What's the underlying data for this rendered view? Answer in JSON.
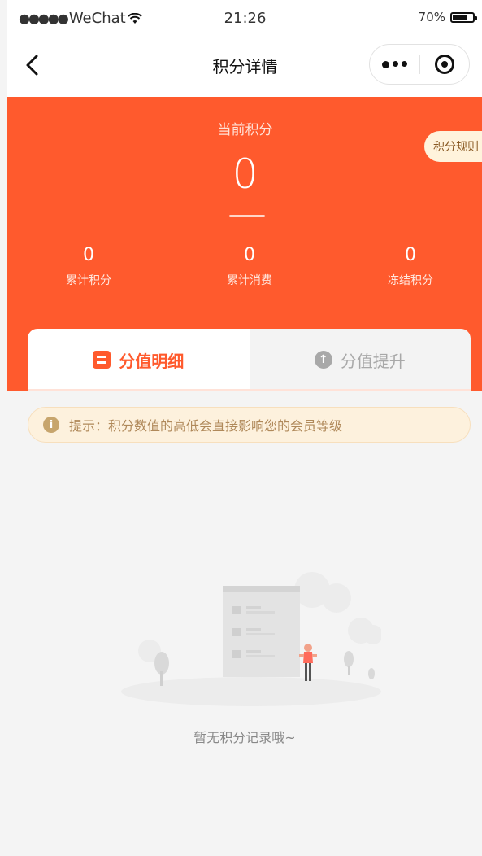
{
  "statusbar": {
    "carrier": "WeChat",
    "time": "21:26",
    "battery_text": "70%",
    "battery_level": 0.7
  },
  "navbar": {
    "title": "积分详情"
  },
  "points": {
    "current_label": "当前积分",
    "current_value": "0",
    "rules_label": "积分规则",
    "stats": [
      {
        "value": "0",
        "label": "累计积分"
      },
      {
        "value": "0",
        "label": "累计消费"
      },
      {
        "value": "0",
        "label": "冻结积分"
      }
    ]
  },
  "tabs": [
    {
      "label": "分值明细",
      "icon": "list-icon",
      "active": true
    },
    {
      "label": "分值提升",
      "icon": "arrow-up-circle-icon",
      "active": false
    }
  ],
  "tip": {
    "text": "提示：积分数值的高低会直接影响您的会员等级"
  },
  "empty": {
    "text": "暂无积分记录哦~"
  },
  "colors": {
    "accent": "#ff5a2d",
    "tip_bg": "#fdf1dd",
    "tip_text": "#b0895a",
    "page_bg": "#f4f4f4"
  }
}
